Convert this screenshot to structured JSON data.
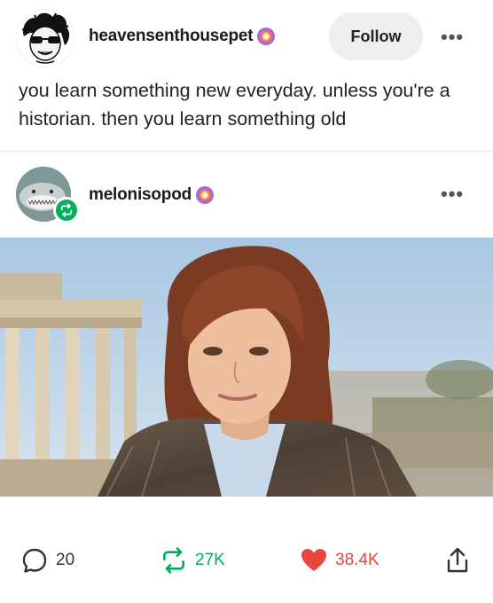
{
  "post": {
    "author": "heavensenthousepet",
    "follow_label": "Follow",
    "more_label": "•••",
    "text": "you learn something new everyday. unless you're a historian. then you learn something old"
  },
  "reblog": {
    "author": "melonisopod",
    "more_label": "•••"
  },
  "footer": {
    "replies": "20",
    "reblogs": "27K",
    "likes": "38.4K"
  },
  "colors": {
    "reblog_green": "#00b05b",
    "like_red": "#e8453c",
    "badge_purple": "#8b5cf6"
  },
  "icons": [
    "badge-icon",
    "more-icon",
    "reblog-icon",
    "reply-icon",
    "heart-icon",
    "share-icon"
  ]
}
